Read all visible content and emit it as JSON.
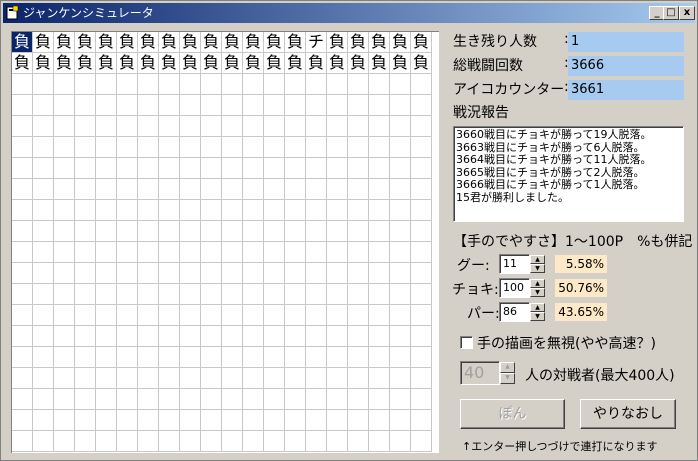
{
  "window": {
    "title": "ジャンケンシミュレータ"
  },
  "titlebar_buttons": {
    "minimize": "_",
    "maximize": "□",
    "close": "x"
  },
  "grid": {
    "rows": [
      [
        "負",
        "負",
        "負",
        "負",
        "負",
        "負",
        "負",
        "負",
        "負",
        "負",
        "負",
        "負",
        "負",
        "負",
        "チ",
        "負",
        "負",
        "負",
        "負",
        "負"
      ],
      [
        "負",
        "負",
        "負",
        "負",
        "負",
        "負",
        "負",
        "負",
        "負",
        "負",
        "負",
        "負",
        "負",
        "負",
        "負",
        "負",
        "負",
        "負",
        "負",
        "負"
      ]
    ],
    "total_rows": 20,
    "selected_cell": "0-0"
  },
  "stats": {
    "survivors_label": "生き残り人数",
    "survivors_value": "1",
    "battles_label": "総戦闘回数",
    "battles_value": "3666",
    "aiko_label": "アイコカウンター",
    "aiko_value": "3661",
    "colon": ":"
  },
  "report": {
    "label": "戦況報告",
    "lines": [
      "3660戦目にチョキが勝って19人脱落。",
      "3663戦目にチョキが勝って6人脱落。",
      "3664戦目にチョキが勝って11人脱落。",
      "3665戦目にチョキが勝って2人脱落。",
      "3666戦目にチョキが勝って1人脱落。",
      "15君が勝利しました。"
    ]
  },
  "ease": {
    "heading": "【手のでやすさ】1～100P　%も併記",
    "rock_label": "グー:",
    "rock_value": "11",
    "rock_pct": "5.58%",
    "scissors_label": "チョキ:",
    "scissors_value": "100",
    "scissors_pct": "50.76%",
    "paper_label": "パー:",
    "paper_value": "86",
    "paper_pct": "43.65%"
  },
  "skip_draw": {
    "label": "手の描画を無視(やや高速？)",
    "checked": false
  },
  "opponents": {
    "value": "40",
    "label": "人の対戦者(最大400人)"
  },
  "buttons": {
    "pon": "ぽん",
    "redo": "やりなおし"
  },
  "hint": "↑エンター押しつづけで連打になります",
  "colors": {
    "titlebar_start": "#0a246a",
    "titlebar_end": "#a6caf0",
    "value_box": "#a6caf0",
    "pct_box": "#fde9c8"
  }
}
